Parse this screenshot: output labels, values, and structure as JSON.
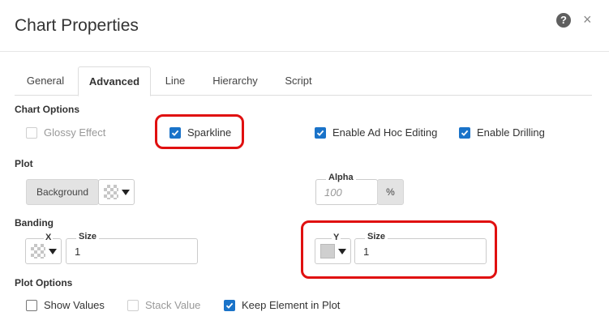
{
  "dialog": {
    "title": "Chart Properties",
    "help_glyph": "?",
    "close_glyph": "×"
  },
  "tabs": [
    {
      "label": "General",
      "active": false
    },
    {
      "label": "Advanced",
      "active": true
    },
    {
      "label": "Line",
      "active": false
    },
    {
      "label": "Hierarchy",
      "active": false
    },
    {
      "label": "Script",
      "active": false
    }
  ],
  "chart_options": {
    "label": "Chart Options",
    "glossy": {
      "label": "Glossy Effect",
      "checked": false,
      "disabled": true
    },
    "sparkline": {
      "label": "Sparkline",
      "checked": true
    },
    "ad_hoc": {
      "label": "Enable Ad Hoc Editing",
      "checked": true
    },
    "drilling": {
      "label": "Enable Drilling",
      "checked": true
    }
  },
  "plot": {
    "label": "Plot",
    "background_button": "Background",
    "alpha": {
      "label": "Alpha",
      "placeholder": "100",
      "unit": "%"
    }
  },
  "banding": {
    "label": "Banding",
    "x": {
      "label": "X",
      "size_label": "Size",
      "size_value": "1"
    },
    "y": {
      "label": "Y",
      "size_label": "Size",
      "size_value": "1"
    }
  },
  "plot_options": {
    "label": "Plot Options",
    "show_values": {
      "label": "Show Values",
      "checked": false
    },
    "stack_value": {
      "label": "Stack Value",
      "checked": false,
      "disabled": true
    },
    "keep_element": {
      "label": "Keep Element in Plot",
      "checked": true
    }
  },
  "colors": {
    "accent": "#1a73c9",
    "highlight": "#e01010"
  }
}
